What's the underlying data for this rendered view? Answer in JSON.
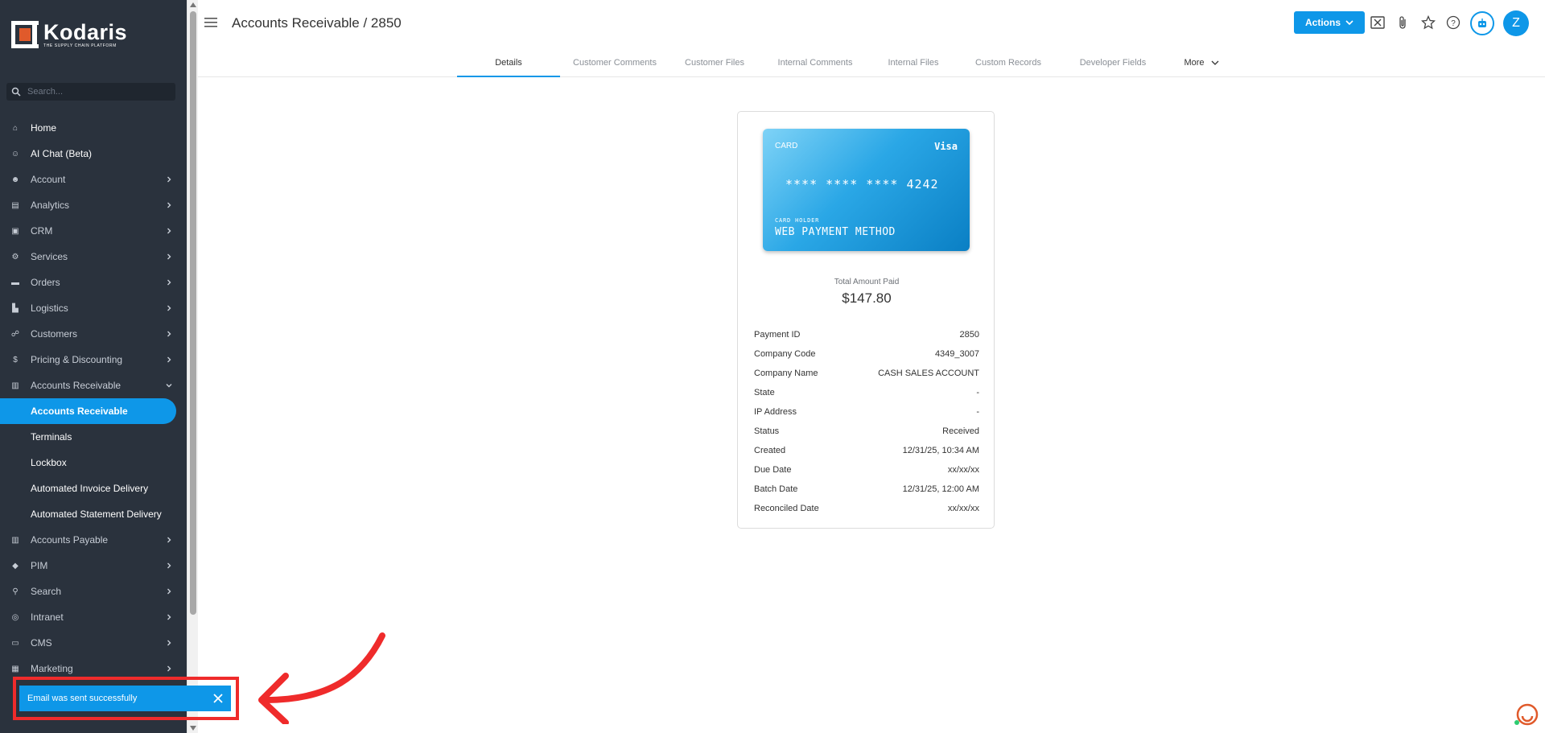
{
  "brand": {
    "name": "Kodaris",
    "tagline": "THE SUPPLY CHAIN PLATFORM",
    "accent": "#0e97e8",
    "logo_color": "#e05a2b"
  },
  "sidebar": {
    "search_placeholder": "Search...",
    "items": [
      {
        "label": "Home",
        "icon": "home-icon",
        "chevron": false
      },
      {
        "label": "AI Chat (Beta)",
        "icon": "robot-icon",
        "chevron": false
      },
      {
        "label": "Account",
        "icon": "user-icon",
        "chevron": true
      },
      {
        "label": "Analytics",
        "icon": "analytics-icon",
        "chevron": true
      },
      {
        "label": "CRM",
        "icon": "crm-icon",
        "chevron": true
      },
      {
        "label": "Services",
        "icon": "services-icon",
        "chevron": true
      },
      {
        "label": "Orders",
        "icon": "truck-icon",
        "chevron": true
      },
      {
        "label": "Logistics",
        "icon": "forklift-icon",
        "chevron": true
      },
      {
        "label": "Customers",
        "icon": "people-icon",
        "chevron": true
      },
      {
        "label": "Pricing & Discounting",
        "icon": "dollar-icon",
        "chevron": true
      },
      {
        "label": "Accounts Receivable",
        "icon": "bank-icon",
        "chevron": true,
        "expanded": true
      }
    ],
    "subitems": [
      {
        "label": "Accounts Receivable",
        "active": true
      },
      {
        "label": "Terminals",
        "active": false
      },
      {
        "label": "Lockbox",
        "active": false
      },
      {
        "label": "Automated Invoice Delivery",
        "active": false
      },
      {
        "label": "Automated Statement Delivery",
        "active": false
      }
    ],
    "items_after": [
      {
        "label": "Accounts Payable",
        "icon": "bank-icon",
        "chevron": true
      },
      {
        "label": "PIM",
        "icon": "tag-icon",
        "chevron": true
      },
      {
        "label": "Search",
        "icon": "search-icon",
        "chevron": true
      },
      {
        "label": "Intranet",
        "icon": "globe-icon",
        "chevron": true
      },
      {
        "label": "CMS",
        "icon": "cms-icon",
        "chevron": true
      },
      {
        "label": "Marketing",
        "icon": "marketing-icon",
        "chevron": true
      }
    ]
  },
  "header": {
    "title": "Accounts Receivable / 2850",
    "actions_label": "Actions",
    "avatar_initial": "Z"
  },
  "tabs": [
    "Details",
    "Customer Comments",
    "Customer Files",
    "Internal Comments",
    "Internal Files",
    "Custom Records",
    "Developer Fields",
    "More"
  ],
  "card": {
    "type_label": "CARD",
    "brand": "Visa",
    "number": "**** **** **** 4242",
    "holder_label": "CARD HOLDER",
    "holder": "WEB PAYMENT METHOD"
  },
  "total": {
    "label": "Total Amount Paid",
    "value": "$147.80"
  },
  "details": [
    {
      "label": "Payment ID",
      "value": "2850"
    },
    {
      "label": "Company Code",
      "value": "4349_3007"
    },
    {
      "label": "Company Name",
      "value": "CASH SALES ACCOUNT"
    },
    {
      "label": "State",
      "value": "-"
    },
    {
      "label": "IP Address",
      "value": "-"
    },
    {
      "label": "Status",
      "value": "Received"
    },
    {
      "label": "Created",
      "value": "12/31/25, 10:34 AM"
    },
    {
      "label": "Due Date",
      "value": "xx/xx/xx"
    },
    {
      "label": "Batch Date",
      "value": "12/31/25, 12:00 AM"
    },
    {
      "label": "Reconciled Date",
      "value": "xx/xx/xx"
    }
  ],
  "toast": {
    "message": "Email was sent successfully",
    "highlight_color": "#ef2b2b"
  }
}
